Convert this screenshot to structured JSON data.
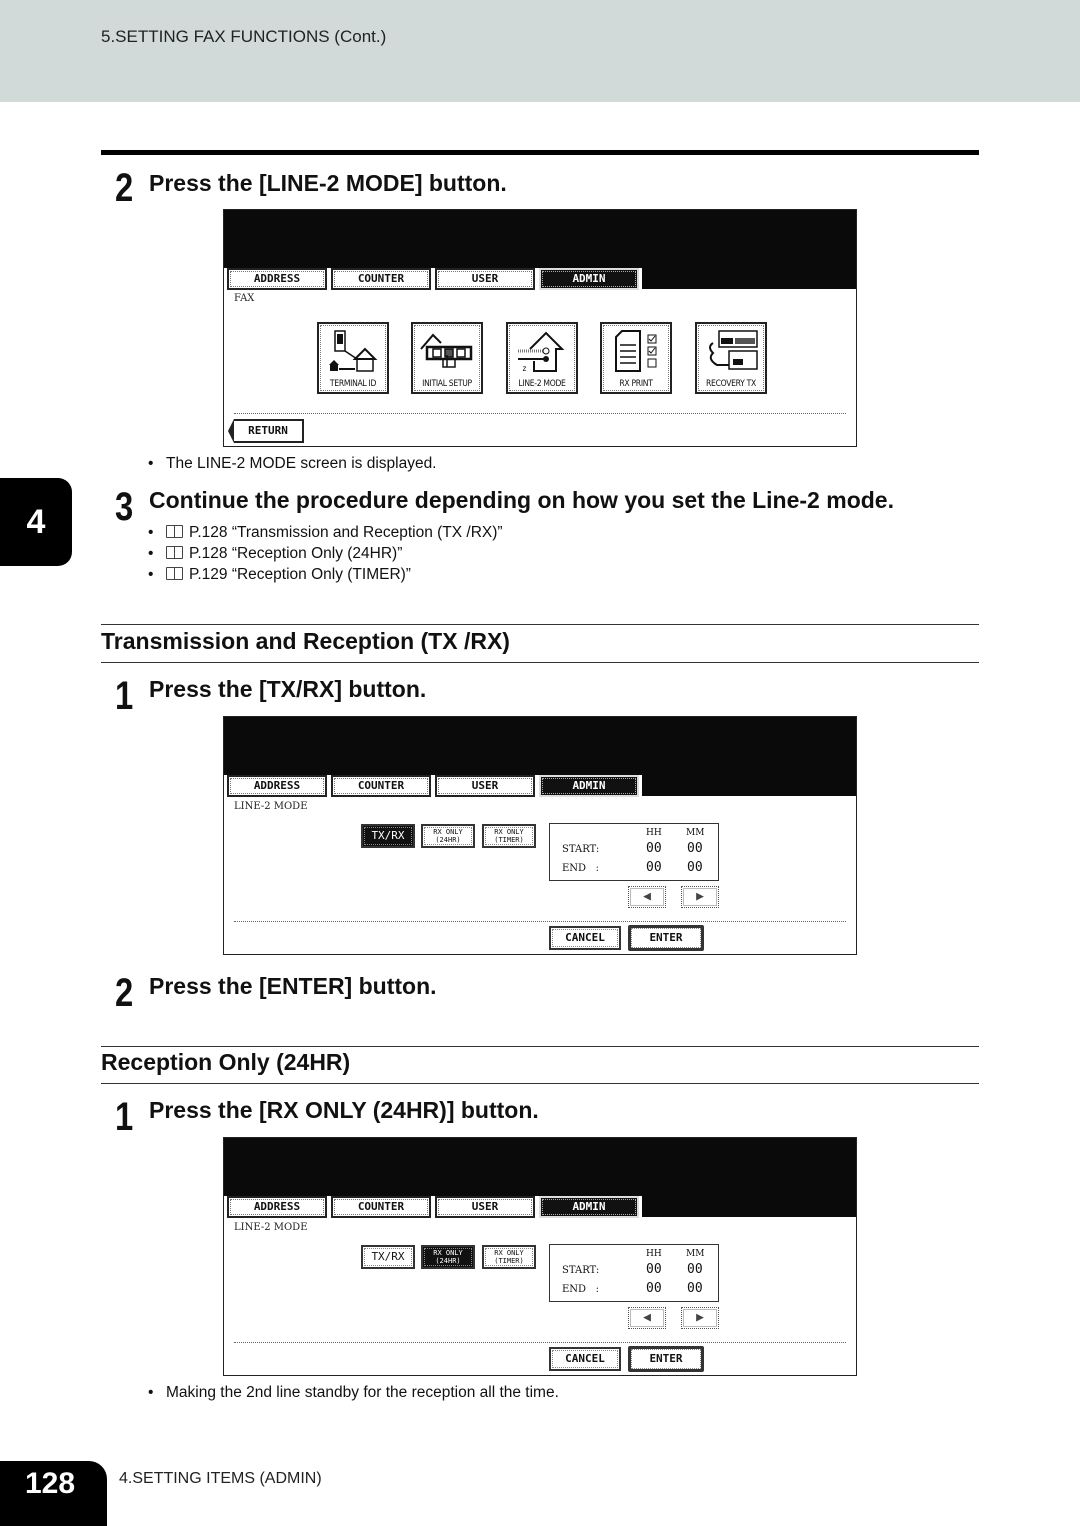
{
  "header": {
    "title": "5.SETTING FAX FUNCTIONS (Cont.)"
  },
  "chapter_tab": "4",
  "footer": {
    "page_number": "128",
    "section": "4.SETTING ITEMS (ADMIN)"
  },
  "step_a": {
    "number": "2",
    "title": "Press the [LINE-2 MODE] button.",
    "screen": {
      "tabs": [
        "ADDRESS",
        "COUNTER",
        "USER",
        "ADMIN"
      ],
      "active_tab": "ADMIN",
      "label": "FAX",
      "buttons": [
        {
          "label": "TERMINAL ID",
          "icon": "terminal-id-icon"
        },
        {
          "label": "INITIAL SETUP",
          "icon": "initial-setup-icon"
        },
        {
          "label": "LINE-2 MODE",
          "icon": "line2-mode-icon"
        },
        {
          "label": "RX PRINT",
          "icon": "rx-print-icon"
        },
        {
          "label": "RECOVERY TX",
          "icon": "recovery-tx-icon"
        }
      ],
      "return_label": "RETURN"
    },
    "note": "The LINE-2 MODE screen is displayed."
  },
  "step_b": {
    "number": "3",
    "title": "Continue the procedure depending on how you set the Line-2 mode.",
    "refs": [
      "P.128 “Transmission and Reception (TX /RX)”",
      "P.128 “Reception Only (24HR)”",
      "P.129 “Reception Only (TIMER)”"
    ]
  },
  "section_txrx": {
    "title": "Transmission and Reception (TX /RX)",
    "step1": {
      "number": "1",
      "title": "Press the [TX/RX] button.",
      "screen": {
        "tabs": [
          "ADDRESS",
          "COUNTER",
          "USER",
          "ADMIN"
        ],
        "label": "LINE-2 MODE",
        "modes": [
          {
            "line1": "TX/RX",
            "line2": ""
          },
          {
            "line1": "RX ONLY",
            "line2": "(24HR)"
          },
          {
            "line1": "RX ONLY",
            "line2": "(TIMER)"
          }
        ],
        "active_mode": 0,
        "time": {
          "hh_label": "HH",
          "mm_label": "MM",
          "start_label": "START:",
          "end_label": "END   :",
          "start_hh": "00",
          "start_mm": "00",
          "end_hh": "00",
          "end_mm": "00"
        },
        "left_arrow": "◀",
        "right_arrow": "▶",
        "cancel_label": "CANCEL",
        "enter_label": "ENTER"
      }
    },
    "step2": {
      "number": "2",
      "title": "Press the [ENTER] button."
    }
  },
  "section_24hr": {
    "title": "Reception Only (24HR)",
    "step1": {
      "number": "1",
      "title": "Press the [RX ONLY (24HR)] button.",
      "screen": {
        "tabs": [
          "ADDRESS",
          "COUNTER",
          "USER",
          "ADMIN"
        ],
        "label": "LINE-2 MODE",
        "modes": [
          {
            "line1": "TX/RX",
            "line2": ""
          },
          {
            "line1": "RX ONLY",
            "line2": "(24HR)"
          },
          {
            "line1": "RX ONLY",
            "line2": "(TIMER)"
          }
        ],
        "active_mode": 1,
        "time": {
          "hh_label": "HH",
          "mm_label": "MM",
          "start_label": "START:",
          "end_label": "END   :",
          "start_hh": "00",
          "start_mm": "00",
          "end_hh": "00",
          "end_mm": "00"
        },
        "left_arrow": "◀",
        "right_arrow": "▶",
        "cancel_label": "CANCEL",
        "enter_label": "ENTER"
      },
      "note": "Making the 2nd line standby for the reception all the time."
    }
  }
}
